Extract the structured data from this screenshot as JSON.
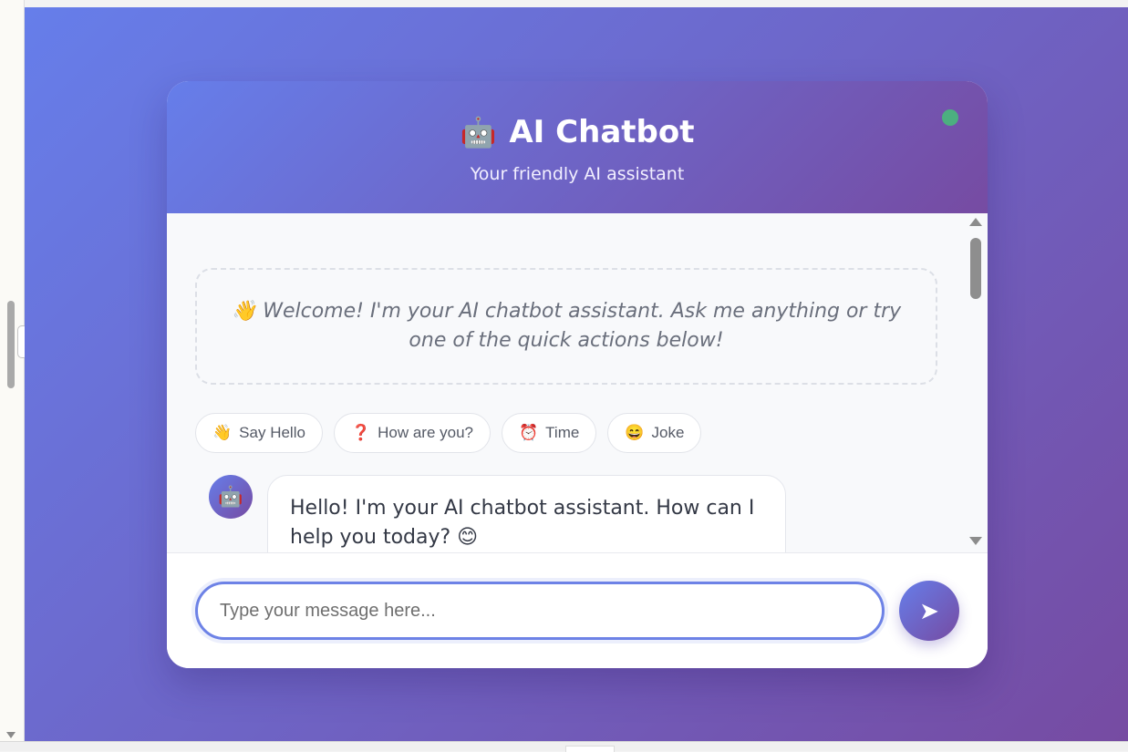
{
  "header": {
    "robot_icon": "🤖",
    "title": "AI Chatbot",
    "subtitle": "Your friendly AI assistant",
    "status_color": "#4caf80"
  },
  "welcome": {
    "text": "👋 Welcome! I'm your AI chatbot assistant. Ask me anything or try one of the quick actions below!"
  },
  "quick_actions": [
    {
      "emoji": "👋",
      "label": "Say Hello"
    },
    {
      "emoji": "❓",
      "label": "How are you?"
    },
    {
      "emoji": "⏰",
      "label": "Time"
    },
    {
      "emoji": "😄",
      "label": "Joke"
    }
  ],
  "messages": [
    {
      "sender": "bot",
      "avatar": "🤖",
      "text": "Hello! I'm your AI chatbot assistant. How can I help you today? 😊"
    }
  ],
  "composer": {
    "placeholder": "Type your message here...",
    "send_icon": "➤"
  },
  "theme": {
    "gradient_start": "#667eea",
    "gradient_end": "#764ba2"
  }
}
